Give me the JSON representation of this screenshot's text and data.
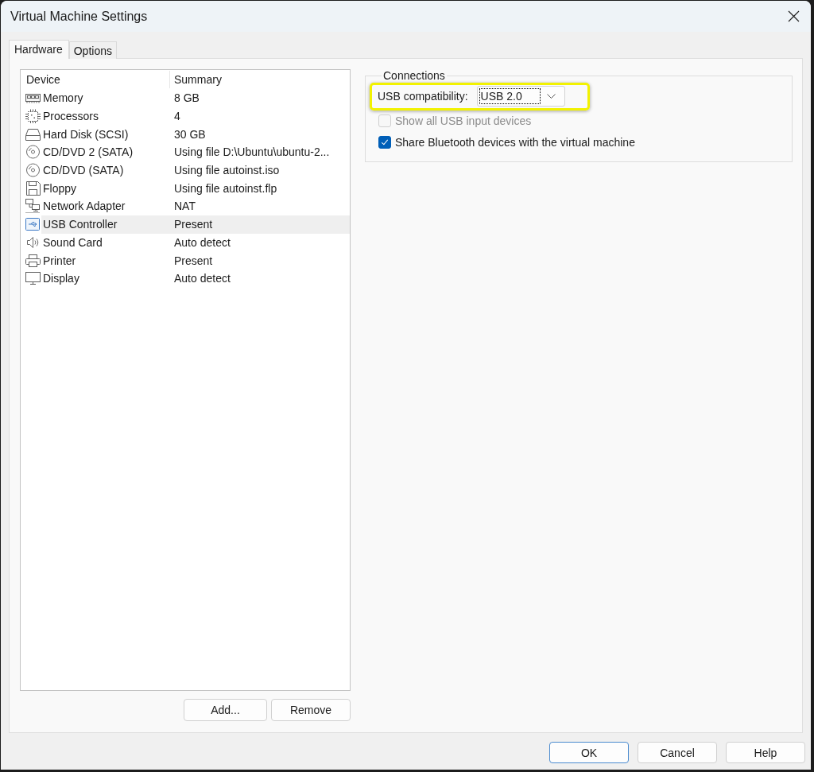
{
  "window": {
    "title": "Virtual Machine Settings"
  },
  "tabs": [
    {
      "label": "Hardware",
      "selected": true
    },
    {
      "label": "Options",
      "selected": false
    }
  ],
  "device_table": {
    "columns": [
      "Device",
      "Summary"
    ],
    "rows": [
      {
        "device": "Memory",
        "summary": "8 GB",
        "kind": "memory",
        "selected": false
      },
      {
        "device": "Processors",
        "summary": "4",
        "kind": "processor",
        "selected": false
      },
      {
        "device": "Hard Disk (SCSI)",
        "summary": "30 GB",
        "kind": "disk",
        "selected": false
      },
      {
        "device": "CD/DVD 2 (SATA)",
        "summary": "Using file D:\\Ubuntu\\ubuntu-2...",
        "kind": "cdrom",
        "selected": false
      },
      {
        "device": "CD/DVD (SATA)",
        "summary": "Using file autoinst.iso",
        "kind": "cdrom",
        "selected": false
      },
      {
        "device": "Floppy",
        "summary": "Using file autoinst.flp",
        "kind": "floppy",
        "selected": false
      },
      {
        "device": "Network Adapter",
        "summary": "NAT",
        "kind": "network",
        "selected": false
      },
      {
        "device": "USB Controller",
        "summary": "Present",
        "kind": "usb",
        "selected": true
      },
      {
        "device": "Sound Card",
        "summary": "Auto detect",
        "kind": "sound",
        "selected": false
      },
      {
        "device": "Printer",
        "summary": "Present",
        "kind": "printer",
        "selected": false
      },
      {
        "device": "Display",
        "summary": "Auto detect",
        "kind": "display",
        "selected": false
      }
    ]
  },
  "list_buttons": [
    "Add...",
    "Remove"
  ],
  "connections": {
    "title": "Connections",
    "compatibility": {
      "label": "USB compatibility:",
      "value": "USB 2.0",
      "focused": true,
      "highlighted": true
    },
    "options": [
      {
        "label": "Show all USB input devices",
        "checked": false,
        "disabled": true
      },
      {
        "label": "Share Bluetooth devices with the virtual machine",
        "checked": true,
        "disabled": false
      }
    ]
  },
  "dialog_buttons": [
    {
      "label": "OK",
      "default": true
    },
    {
      "label": "Cancel",
      "default": false
    },
    {
      "label": "Help",
      "default": false
    }
  ]
}
